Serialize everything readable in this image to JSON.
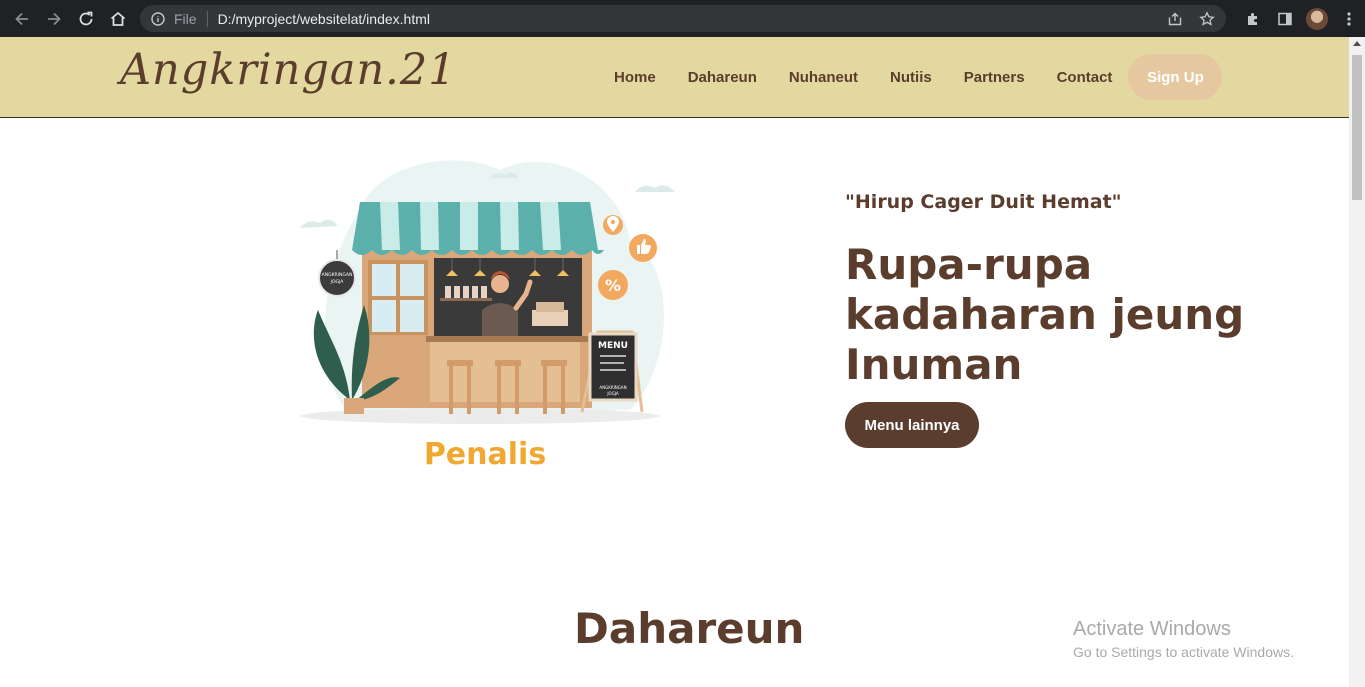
{
  "browser": {
    "file_label": "File",
    "url": "D:/myproject/websitelat/index.html"
  },
  "site": {
    "logo": "Angkringan.21",
    "nav": [
      "Home",
      "Dahareun",
      "Nuhaneut",
      "Nutiis",
      "Partners",
      "Contact"
    ],
    "signup_label": "Sign Up"
  },
  "hero": {
    "tagline": "\"Hirup Cager Duit Hemat\"",
    "headline": "Rupa-rupa kadaharan jeung Inuman",
    "button_label": "Menu lainnya",
    "illustration": {
      "sign_line1": "ANGKRINGAN",
      "sign_line2": "JOGJA",
      "menu_board": "MENU",
      "board_line1": "ANGKRINGAN",
      "board_line2": "JOGJA",
      "brand": "Penalis",
      "percent": "%"
    }
  },
  "sections": {
    "first_title": "Dahareun"
  },
  "watermark": {
    "title": "Activate Windows",
    "subtitle": "Go to Settings to activate Windows."
  },
  "colors": {
    "header_bg": "#e2d8a0",
    "brown": "#5b3d2e",
    "signup_bg": "#e6c8a0",
    "brand_orange": "#f0a830"
  },
  "icons": [
    "back-arrow-icon",
    "forward-arrow-icon",
    "reload-icon",
    "home-icon",
    "info-icon",
    "share-icon",
    "star-icon",
    "extension-icon",
    "sidebar-icon",
    "menu-dots-icon"
  ]
}
